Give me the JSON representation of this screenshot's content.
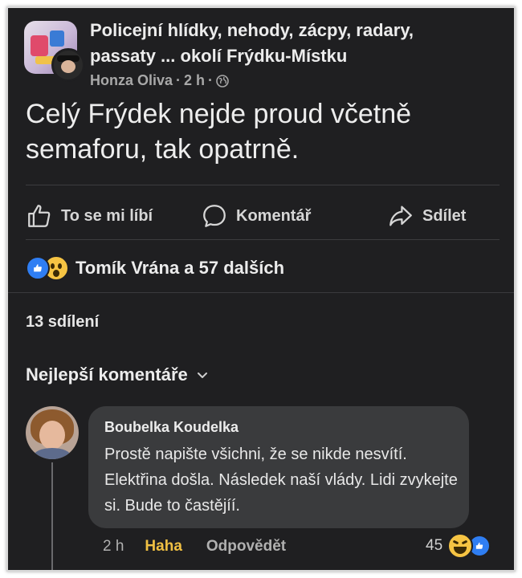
{
  "post": {
    "group_name": "Policejní hlídky, nehody, zácpy, radary, passaty ... okolí Frýdku-Místku",
    "author": "Honza Oliva",
    "time": "2 h",
    "text": "Celý Frýdek nejde proud včetně semaforu, tak opatrně."
  },
  "actions": {
    "like_label": "To se mi líbí",
    "comment_label": "Komentář",
    "share_label": "Sdílet"
  },
  "reactions": {
    "summary": "Tomík Vrána a 57 dalších"
  },
  "shares": {
    "label": "13 sdílení"
  },
  "comments": {
    "sort_label": "Nejlepší komentáře",
    "items": [
      {
        "author": "Boubelka Koudelka",
        "text": "Prostě napište všichni, že se nikde nesvítí.  Elektřina došla. Následek naší vlády. Lidi zvykejte si. Bude to častějíí.",
        "time": "2 h",
        "reaction_label": "Haha",
        "reply_label": "Odpovědět",
        "reaction_count": "45"
      }
    ]
  },
  "colors": {
    "background": "#1f1f21",
    "bubble": "#3a3b3d",
    "haha": "#f0c043",
    "like": "#2f7ef3"
  }
}
